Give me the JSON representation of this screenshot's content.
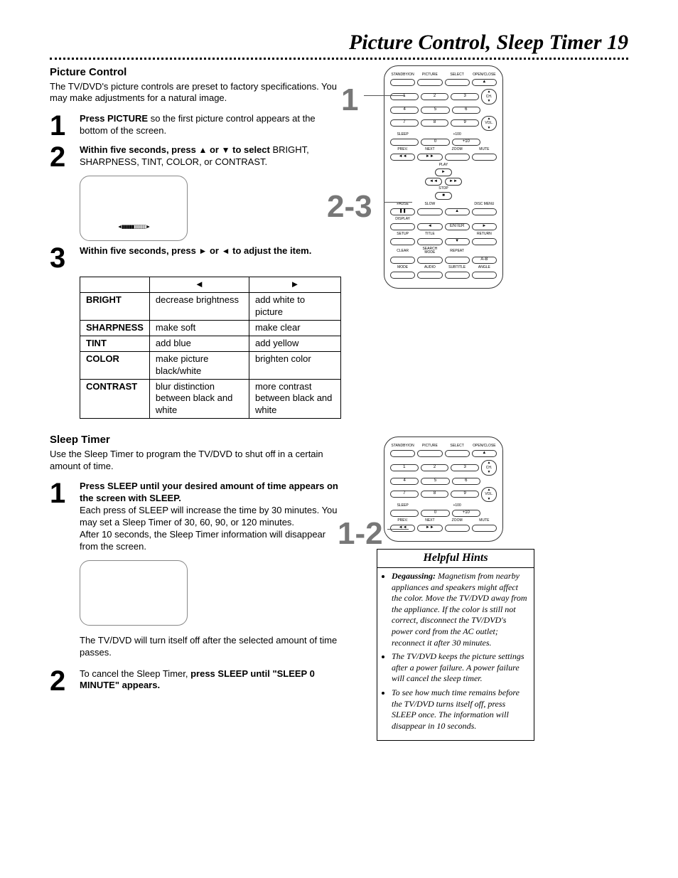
{
  "page_title": "Picture Control, Sleep Timer  19",
  "picture_control": {
    "heading": "Picture Control",
    "intro": "The TV/DVD's picture controls are preset to factory specifications. You may make adjustments for a natural image.",
    "step1_num": "1",
    "step1_bold": "Press PICTURE",
    "step1_rest": " so the first picture control appears at the bottom of the screen.",
    "step2_num": "2",
    "step2_bold_a": "Within five seconds, press ",
    "step2_arrow_up": "▲",
    "step2_bold_mid": " or ",
    "step2_arrow_down": "▼",
    "step2_bold_b": " to select",
    "step2_rest": " BRIGHT, SHARPNESS, TINT, COLOR, or CONTRAST.",
    "screen_bar": "◄▮▮▮▮▮▮▯▯▯▯▯▯►",
    "step3_num": "3",
    "step3_bold_a": "Within five seconds, press ",
    "step3_arrow_r": "►",
    "step3_bold_mid": " or ",
    "step3_arrow_l": "◄",
    "step3_bold_b": " to adjust the item.",
    "table": {
      "head_left": "◄",
      "head_right": "►",
      "rows": [
        {
          "label": "BRIGHT",
          "l": "decrease brightness",
          "r": "add white to picture"
        },
        {
          "label": "SHARPNESS",
          "l": "make soft",
          "r": "make clear"
        },
        {
          "label": "TINT",
          "l": "add blue",
          "r": "add yellow"
        },
        {
          "label": "COLOR",
          "l": "make picture black/white",
          "r": "brighten color"
        },
        {
          "label": "CONTRAST",
          "l": "blur distinction between black and white",
          "r": "more contrast between black and white"
        }
      ]
    },
    "callout1": "1",
    "callout23": "2-3"
  },
  "sleep_timer": {
    "heading": "Sleep Timer",
    "intro": "Use the Sleep Timer to program the TV/DVD to shut off in a certain amount of time.",
    "step1_num": "1",
    "step1_bold": "Press SLEEP until your desired amount of time appears on the screen with SLEEP.",
    "step1_p1": "Each press of SLEEP will increase the time by 30 minutes. You may set a Sleep Timer of 30, 60, 90, or 120 minutes.",
    "step1_p2": "After 10 seconds, the Sleep Timer information will disappear from the screen.",
    "step1_p3": "The TV/DVD will turn itself off after the selected amount of time passes.",
    "step2_num": "2",
    "step2_a": "To cancel the Sleep Timer, ",
    "step2_bold": "press SLEEP until \"SLEEP 0 MINUTE\" appears.",
    "callout12": "1-2"
  },
  "hints": {
    "title": "Helpful Hints",
    "h1_bold": "Degaussing:",
    "h1": " Magnetism from nearby appliances and speakers might affect the color. Move the TV/DVD away from the appliance. If the color is still not correct, disconnect the TV/DVD's power cord from the AC outlet; reconnect it after 30 minutes.",
    "h2": "The TV/DVD keeps the picture settings after a power failure. A power failure will cancel the sleep timer.",
    "h3": "To see how much time remains before the TV/DVD turns itself off, press SLEEP once. The information will disappear in 10 seconds."
  },
  "remote_labels": {
    "r1": [
      "STANDBY/ON",
      "PICTURE",
      "SELECT",
      "OPEN/CLOSE"
    ],
    "nums1": [
      "1",
      "2",
      "3"
    ],
    "ch": "CH.",
    "nums2": [
      "4",
      "5",
      "6"
    ],
    "nums3": [
      "7",
      "8",
      "9"
    ],
    "sleep": "SLEEP",
    "zero": "0",
    "p100": "+100",
    "p10": "+10",
    "vol": "VOL.",
    "prev": "PREV.",
    "next": "NEXT",
    "zoom": "ZOOM",
    "mute": "MUTE",
    "play": "PLAY",
    "stop": "STOP",
    "pause": "PAUSE",
    "slow": "SLOW",
    "disc": "DISC MENU",
    "display": "DISPLAY",
    "setup": "SETUP",
    "title": "TITLE",
    "return": "RETURN",
    "enter": "ENTER",
    "clear": "CLEAR",
    "search": "SEARCH MODE",
    "repeat": "REPEAT",
    "ab": "A-B",
    "mode": "MODE",
    "audio": "AUDIO",
    "subtitle": "SUBTITLE",
    "angle": "ANGLE"
  }
}
